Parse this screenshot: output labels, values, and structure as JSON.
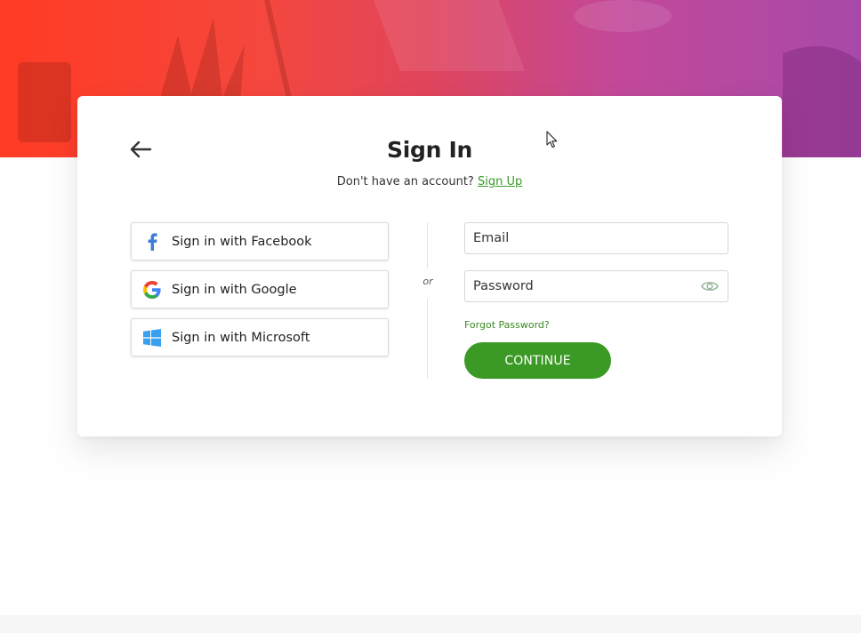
{
  "header": {
    "banner_colors": [
      "#ff3b24",
      "#e0455d",
      "#a849a8"
    ]
  },
  "signin": {
    "back_icon": "arrow-left-icon",
    "title": "Sign In",
    "subtitle_prefix": "Don't have an account?",
    "signup_link": "Sign Up"
  },
  "social": [
    {
      "label": "Sign in with Facebook",
      "icon": "facebook-icon"
    },
    {
      "label": "Sign in with Google",
      "icon": "google-icon"
    },
    {
      "label": "Sign in with Microsoft",
      "icon": "microsoft-icon"
    }
  ],
  "divider": {
    "text": "or"
  },
  "form": {
    "email_placeholder": "Email",
    "email_value": "",
    "password_placeholder": "Password",
    "password_value": "",
    "show_password_icon": "eye-icon",
    "forgot_label": "Forgot Password?",
    "continue_label": "CONTINUE"
  },
  "colors": {
    "accent": "#3b9a25",
    "link": "#3a9a2a",
    "text": "#222222"
  }
}
